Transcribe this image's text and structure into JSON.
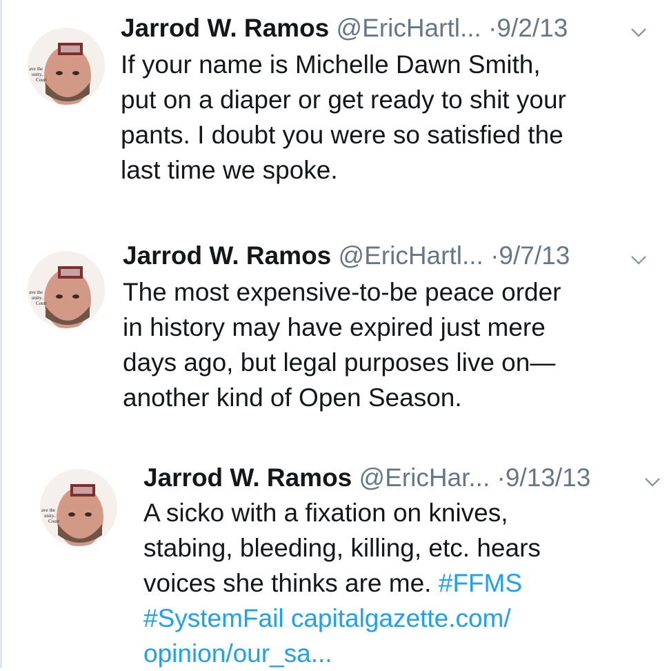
{
  "colors": {
    "text": "#14171a",
    "muted": "#657786",
    "link": "#1da1f2"
  },
  "tweets": [
    {
      "name": "Jarrod W. Ramos",
      "handle": "@EricHartl...",
      "separator": "·",
      "date": "9/2/13",
      "menu_icon": "chevron-down-icon",
      "lines": [
        "If your name is Michelle Dawn Smith,",
        "put on a diaper or get ready to shit your",
        "pants. I doubt you were so satisfied the",
        "last time we spoke."
      ]
    },
    {
      "name": "Jarrod W. Ramos",
      "handle": "@EricHartl...",
      "separator": "·",
      "date": "9/7/13",
      "menu_icon": "chevron-down-icon",
      "lines": [
        "The most expensive-to-be peace order",
        "in history may have expired just mere",
        "days ago, but legal purposes live on—",
        "another kind of Open Season."
      ]
    },
    {
      "name": "Jarrod W. Ramos",
      "handle": "@EricHar...",
      "separator": "·",
      "date": "9/13/13",
      "menu_icon": "chevron-down-icon",
      "line1": "A sicko with a fixation on knives,",
      "line2": "stabing, bleeding, killing, etc. hears",
      "line3": "voices she thinks are me.",
      "hashtag1": "#FFMS",
      "hashtag2": "#SystemFail",
      "link_part1": "capitalgazette.com/",
      "link_part2": "opinion/our_sa..."
    }
  ]
}
